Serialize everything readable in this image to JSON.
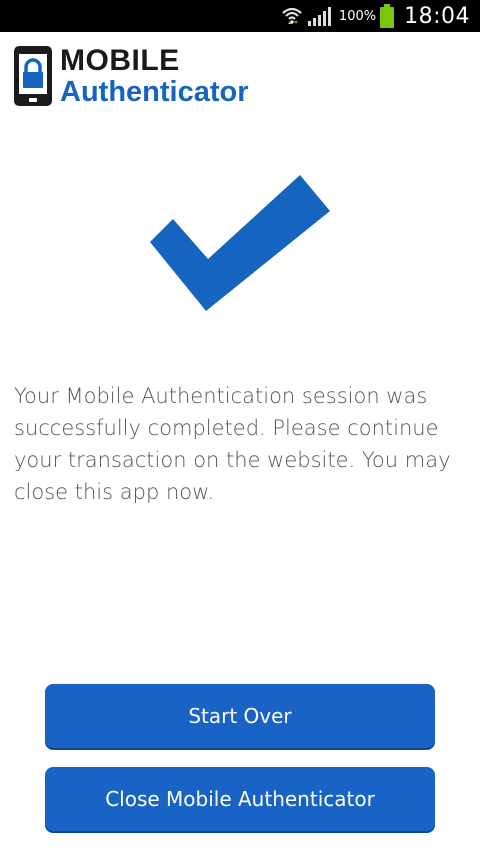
{
  "status_bar": {
    "battery_percent": "100%",
    "time": "18:04"
  },
  "header": {
    "logo_line1": "MOBILE",
    "logo_line2": "Authenticator"
  },
  "main": {
    "message": "Your Mobile Authentication session was successfully completed. Please continue your transaction on the website. You may close this app now."
  },
  "actions": {
    "start_over_label": "Start Over",
    "close_label": "Close Mobile Authenticator"
  },
  "colors": {
    "brand_blue": "#1565c0",
    "button_blue": "#1a63c6",
    "battery_green": "#7cc50a"
  },
  "icons": {
    "wifi": "wifi-icon",
    "signal": "signal-icon",
    "battery": "battery-icon",
    "logo": "phone-lock-icon",
    "check": "checkmark-icon"
  }
}
